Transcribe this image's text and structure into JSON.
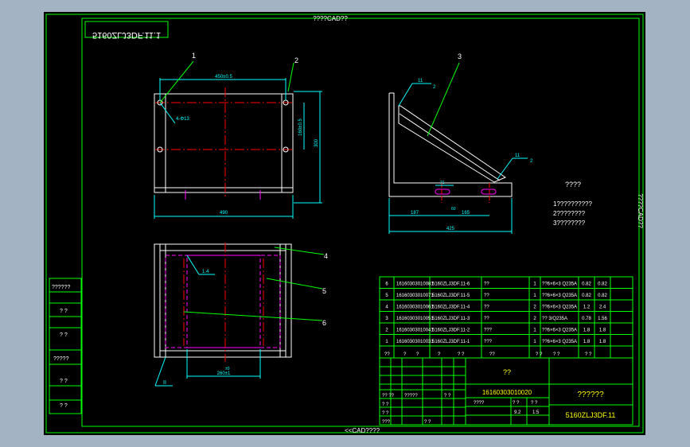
{
  "drawing": {
    "header_text": "????CAD??",
    "footer_text": "<<CAD????",
    "right_edge_text": "????CAD??",
    "mirrored_code": "5160ZLJ3DF.11.1",
    "left_margin_labels": [
      "??????",
      "? ?",
      "? ?",
      "?????",
      "? ?",
      "? ?"
    ]
  },
  "views": {
    "top_view": {
      "dim_top": "450±0.5",
      "dim_bottom": "490",
      "dim_right_outer": "300",
      "dim_right_inner": "160±0.5",
      "hole_note": "4-Φ13",
      "balloon_1": "1",
      "balloon_2": "2"
    },
    "side_view": {
      "balloon_3": "3",
      "weld_upper": "11",
      "weld_upper_2": "2",
      "weld_lower": "11",
      "weld_lower_2": "2",
      "dim_small": "21",
      "dim_left": "187",
      "dim_mid": "165",
      "dim_mid_small": "60",
      "dim_total": "425"
    },
    "bottom_view": {
      "balloon_4": "4",
      "balloon_5": "5",
      "balloon_6": "6",
      "weld_inner": "1.4",
      "weld_bottom": "II",
      "dim_bottom": "260±1",
      "dim_bottom_small": "±0"
    }
  },
  "notes": {
    "title": "????",
    "lines": [
      "1??????????",
      "2????????",
      "3????????"
    ]
  },
  "bom": {
    "rows": [
      {
        "no": "6",
        "code": "16160303010081",
        "drawing": "5160ZLJ3DF.11-6",
        "name": "??",
        "qty": "1",
        "material": "??6×6×3 Q235A",
        "unit_wt": "0.82",
        "total_wt": "0.82"
      },
      {
        "no": "5",
        "code": "16160303010071",
        "drawing": "5160ZLJ3DF.11-5",
        "name": "??",
        "qty": "1",
        "material": "??6×6×3 Q235A",
        "unit_wt": "0.82",
        "total_wt": "0.82"
      },
      {
        "no": "4",
        "code": "16160303010061",
        "drawing": "5160ZLJ3DF.11-4",
        "name": "??",
        "qty": "2",
        "material": "??6×6×3 Q235A",
        "unit_wt": "1.2",
        "total_wt": "2.4"
      },
      {
        "no": "3",
        "code": "16160303010051",
        "drawing": "5160ZLJ3DF.11-3",
        "name": "??",
        "qty": "2",
        "material": "?? 3/Q235A",
        "unit_wt": "0.78",
        "total_wt": "1.56"
      },
      {
        "no": "2",
        "code": "16160303010041",
        "drawing": "5160ZLJ3DF.11-2",
        "name": "???",
        "qty": "1",
        "material": "??6×6×3 Q235A",
        "unit_wt": "1.8",
        "total_wt": "1.8"
      },
      {
        "no": "1",
        "code": "16160303010031",
        "drawing": "5160ZLJ3DF.11-1",
        "name": "???",
        "qty": "1",
        "material": "??6×6×3 Q235A",
        "unit_wt": "1.8",
        "total_wt": "1.8"
      }
    ],
    "header": [
      "??",
      "?",
      "?",
      "?",
      "? ?",
      "??",
      "? ?",
      "? ?",
      "? ?"
    ]
  },
  "title_block": {
    "part_name": "??",
    "part_code": "16160303010020",
    "company": "??????",
    "drawing_no": "5160ZLJ3DF.11",
    "scale": "1:5",
    "weight": "9.2",
    "mass_label": "? ?",
    "sheet_label": "? ?",
    "stage_label": "????",
    "left_cells": [
      "?? ??",
      "?????",
      "? ?",
      "? ?",
      "? ?",
      "? ?",
      "???"
    ]
  },
  "colors": {
    "frame": "#00ff00",
    "outline": "#ffffff",
    "dimension": "#00ffff",
    "center": "#ff0000",
    "hidden": "#ff00ff",
    "leader": "#00ff00",
    "title_text": "#ffff00"
  }
}
